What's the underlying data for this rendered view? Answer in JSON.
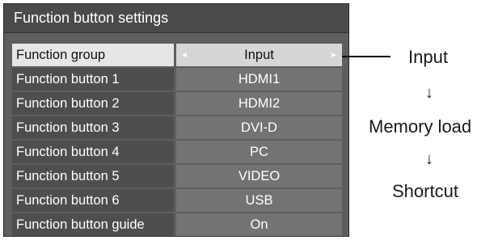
{
  "panel": {
    "title": "Function button settings"
  },
  "rows": [
    {
      "label": "Function group",
      "value": "Input",
      "arrow_left": "◂",
      "arrow_right": "▸"
    },
    {
      "label": "Function button 1",
      "value": "HDMI1"
    },
    {
      "label": "Function button 2",
      "value": "HDMI2"
    },
    {
      "label": "Function button 3",
      "value": "DVI-D"
    },
    {
      "label": "Function button 4",
      "value": "PC"
    },
    {
      "label": "Function button 5",
      "value": "VIDEO"
    },
    {
      "label": "Function button 6",
      "value": "USB"
    },
    {
      "label": "Function button guide",
      "value": "On"
    }
  ],
  "options": {
    "items": [
      "Input",
      "Memory load",
      "Shortcut"
    ],
    "arrow": "↓"
  }
}
